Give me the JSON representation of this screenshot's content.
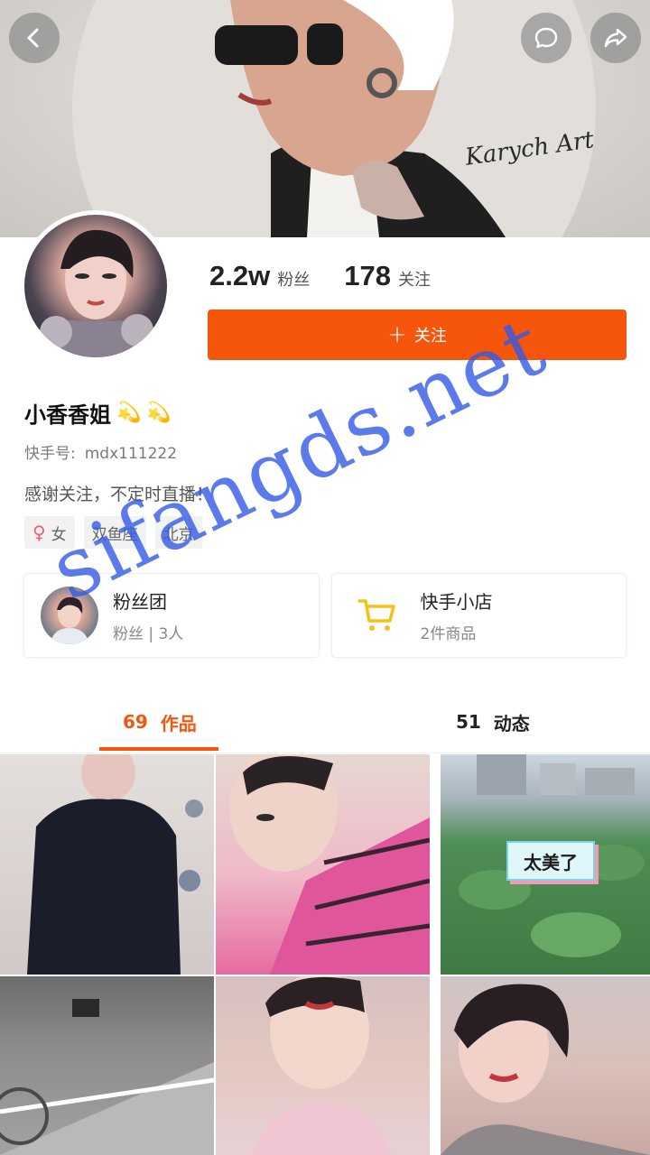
{
  "header": {
    "back_icon": "chevron-left-icon",
    "comment_icon": "speech-bubble-icon",
    "share_icon": "share-arrow-icon",
    "cover_signature": "Karych Art"
  },
  "profile": {
    "fans_count": "2.2w",
    "fans_label": "粉丝",
    "following_count": "178",
    "following_label": "关注",
    "follow_button_label": "关注",
    "name": "小香香姐",
    "name_badges": [
      "💫",
      "💫"
    ],
    "id_label": "快手号:",
    "id_value": "mdx111222",
    "bio": "感谢关注，不定时直播！",
    "tags": [
      {
        "icon": "female-icon",
        "label": "女"
      },
      {
        "label": "双鱼座"
      },
      {
        "label": "北京"
      }
    ]
  },
  "cards": {
    "fan_group": {
      "title": "粉丝团",
      "subtitle": "粉丝 | 3人"
    },
    "shop": {
      "title": "快手小店",
      "subtitle": "2件商品",
      "icon": "shopping-cart-icon"
    }
  },
  "tabs": [
    {
      "count": "69",
      "label": "作品",
      "active": true
    },
    {
      "count": "51",
      "label": "动态",
      "active": false
    }
  ],
  "grid": {
    "sticker_text": "太美了"
  },
  "watermark": "sifangds.net",
  "colors": {
    "accent": "#f5560b",
    "watermark": "#3b63e6",
    "sticker_border": "#79d4e6"
  }
}
